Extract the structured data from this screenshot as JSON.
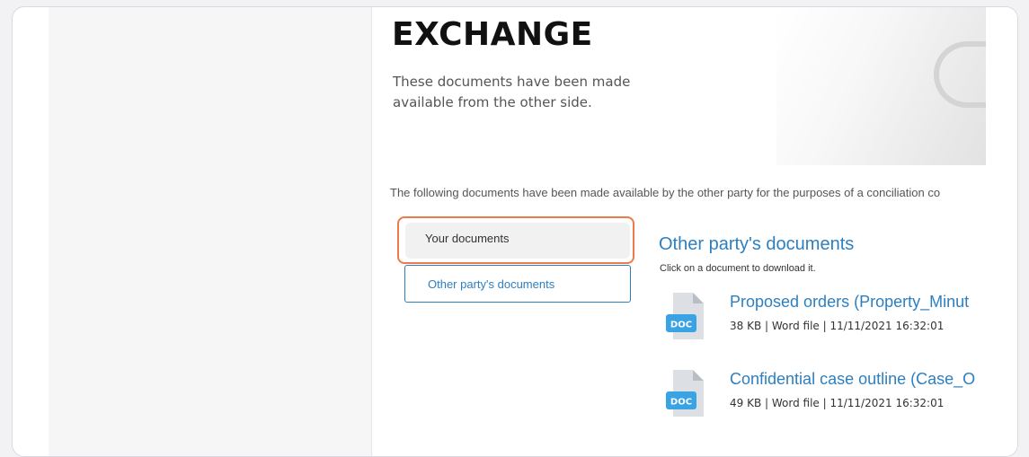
{
  "header": {
    "title": "EXCHANGE",
    "subtitle": "These documents have been made available from the other side."
  },
  "intro_text": "The following documents have been made available by the other party for the purposes of a conciliation co",
  "tabs": [
    {
      "label": "Your documents",
      "selected": false
    },
    {
      "label": "Other party's documents",
      "selected": true
    }
  ],
  "section": {
    "title": "Other party's documents",
    "hint": "Click on a document to download it."
  },
  "documents": [
    {
      "name": "Proposed orders (Property_Minut",
      "meta": "38 KB | Word file | 11/11/2021 16:32:01",
      "icon_label": "DOC"
    },
    {
      "name": "Confidential case outline (Case_O",
      "meta": "49 KB | Word file | 11/11/2021 16:32:01",
      "icon_label": "DOC"
    }
  ],
  "colors": {
    "accent": "#2d7fbf",
    "highlight": "#ec7a4b",
    "doc_icon_badge": "#3aa3e3"
  }
}
